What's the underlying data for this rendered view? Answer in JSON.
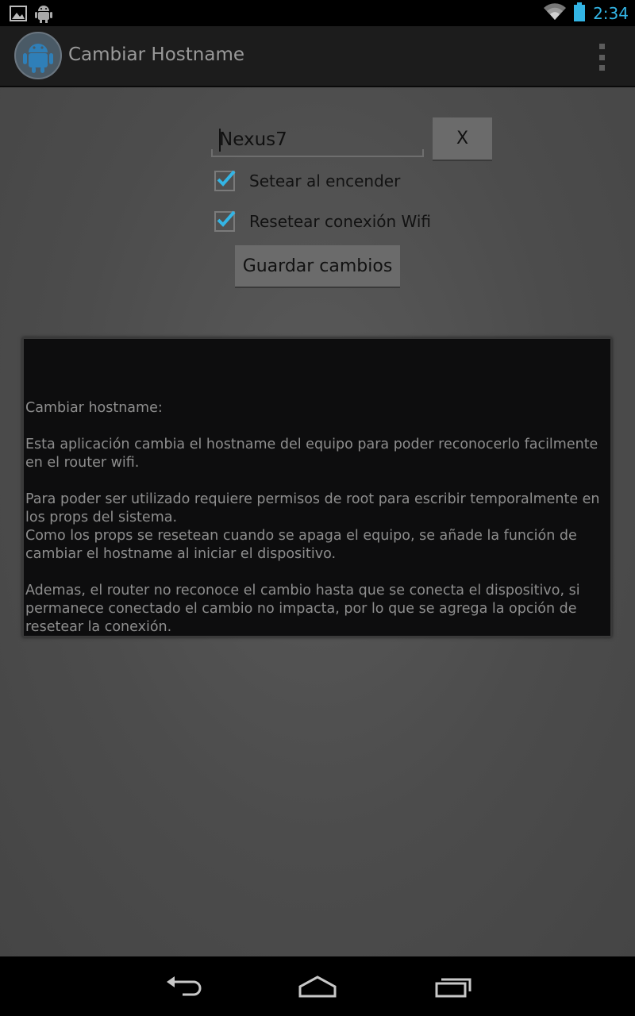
{
  "status_bar": {
    "time": "2:34",
    "time_color": "#33b5e5",
    "left_icons": [
      "gallery-notification-icon",
      "android-debug-icon"
    ],
    "right_icons": [
      "wifi-icon",
      "battery-icon"
    ]
  },
  "action_bar": {
    "title": "Cambiar Hostname",
    "app_icon": "android-app-icon",
    "overflow_icon": "overflow-menu-icon"
  },
  "form": {
    "hostname_value": "Nexus7",
    "clear_button": "X",
    "options": [
      {
        "label": "Setear al encender",
        "checked": true
      },
      {
        "label": "Resetear conexión Wifi",
        "checked": true
      }
    ],
    "save_button": "Guardar cambios",
    "accent_color": "#33b5e5"
  },
  "info": {
    "heading": "Cambiar hostname:",
    "paragraph1": "Esta aplicación cambia el hostname del equipo para poder reconocerlo facilmente en el router wifi.",
    "paragraph2a": "Para poder ser utilizado requiere permisos de root para escribir temporalmente en los props del sistema.",
    "paragraph2b": "Como los props se resetean cuando se apaga el equipo, se añade la función de cambiar el hostname al iniciar el dispositivo.",
    "paragraph3": "Ademas, el router no reconoce el cambio hasta que se conecta el dispositivo, si permanece conectado el cambio no impacta, por lo que se agrega la opción de resetear la conexión."
  },
  "nav_bar": {
    "icons": [
      "back-icon",
      "home-icon",
      "recent-apps-icon"
    ]
  }
}
